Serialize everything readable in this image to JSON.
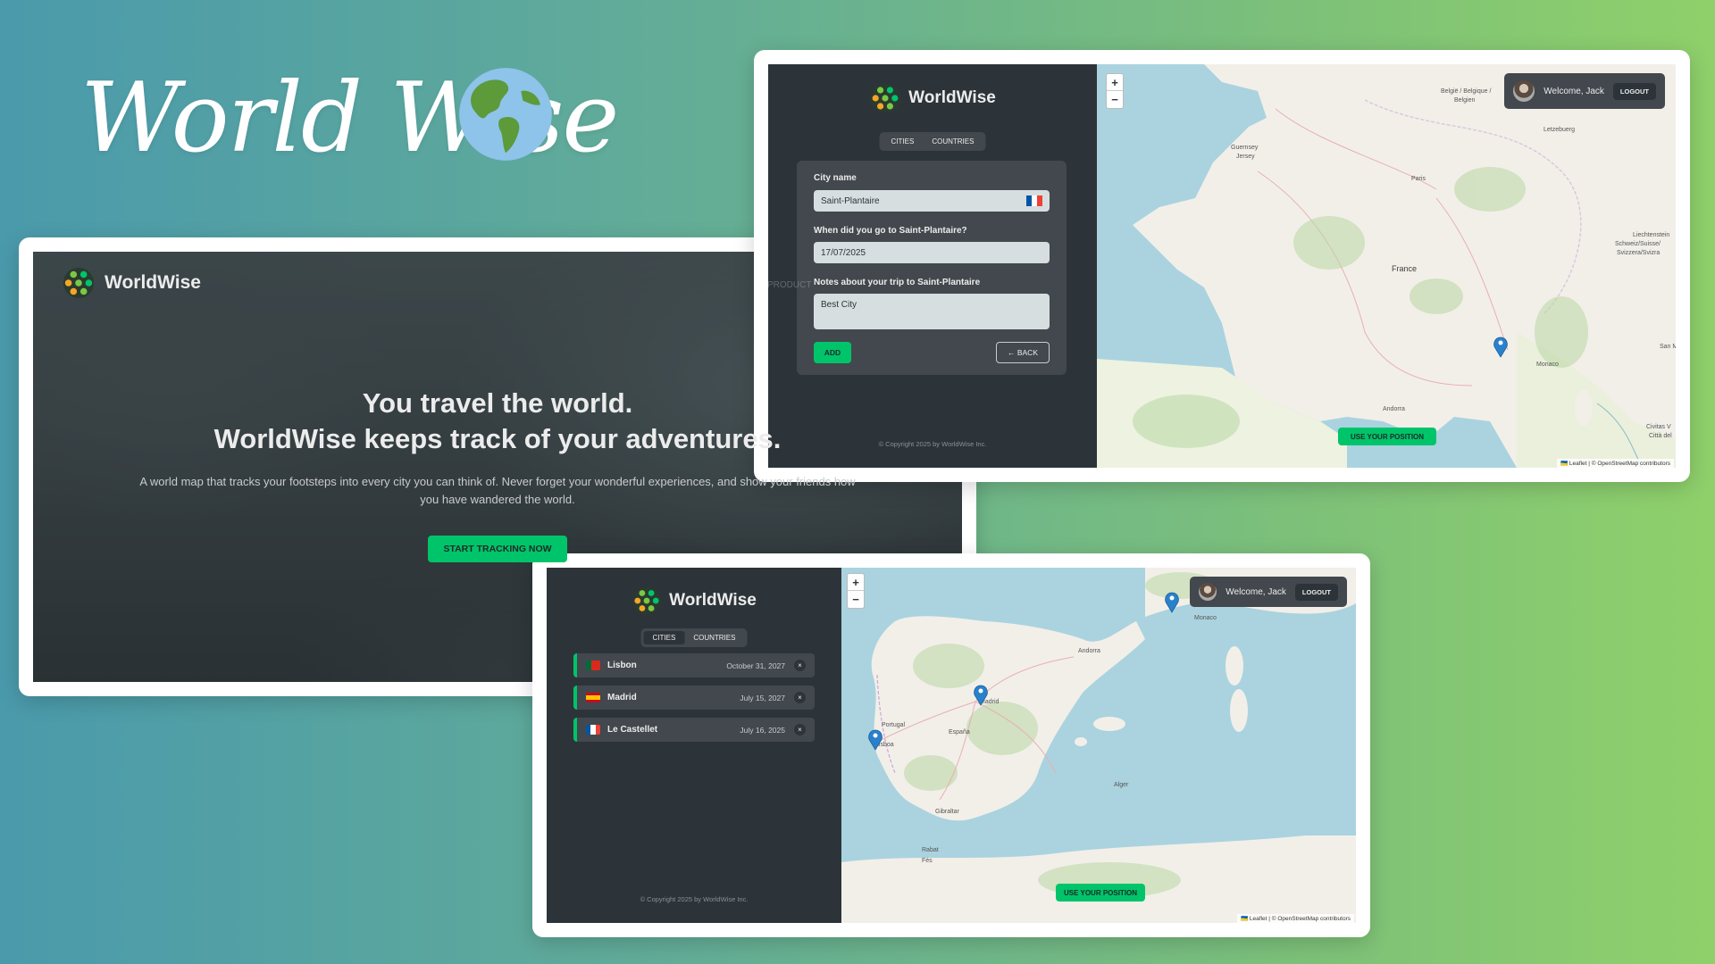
{
  "hero": {
    "script_title": "World Wise"
  },
  "brand": {
    "name": "WorldWise"
  },
  "home": {
    "nav_ghost": "PRODUCT",
    "headline_line1": "You travel the world.",
    "headline_line2": "WorldWise keeps track of your adventures.",
    "description_line1": "A world map that tracks your footsteps into every city you can think of. Never forget your wonderful experiences, and show your friends how",
    "description_line2": "you have wandered the world.",
    "cta_label": "START TRACKING NOW"
  },
  "tabs": {
    "cities": "CITIES",
    "countries": "COUNTRIES"
  },
  "form": {
    "city_label": "City name",
    "city_value": "Saint-Plantaire",
    "date_label": "When did you go to Saint-Plantaire?",
    "date_value": "17/07/2025",
    "notes_label": "Notes about your trip to Saint-Plantaire",
    "notes_value": "Best City",
    "add_label": "ADD",
    "back_label": "← BACK"
  },
  "footer": {
    "copyright": "© Copyright 2025 by WorldWise Inc."
  },
  "user": {
    "welcome": "Welcome, Jack",
    "logout_label": "LOGOUT"
  },
  "map": {
    "zoom_in": "+",
    "zoom_out": "−",
    "use_position": "USE YOUR POSITION",
    "attribution": "🇺🇦 Leaflet | © OpenStreetMap contributors",
    "labels_france": [
      "België / Belgique / Belgien",
      "Letzebuerg",
      "Guernsey",
      "Jersey",
      "Paris",
      "France",
      "Liechtenstein",
      "Schweiz/Suisse/",
      "Svizzera/Svizra",
      "Monaco",
      "Andorra",
      "San M",
      "Civitas V",
      "Città del"
    ],
    "labels_iberia": [
      "Monaco",
      "Andorra",
      "Portugal",
      "Madrid",
      "Lisboa",
      "España",
      "Gibraltar",
      "Rabat",
      "Fès",
      "Alger"
    ]
  },
  "cities": [
    {
      "name": "Lisbon",
      "date": "October 31, 2027",
      "flag": "portugal"
    },
    {
      "name": "Madrid",
      "date": "July 15, 2027",
      "flag": "spain"
    },
    {
      "name": "Le Castellet",
      "date": "July 16, 2025",
      "flag": "france"
    }
  ],
  "colors": {
    "brand_green": "#00c46a",
    "sidebar": "#2d3439",
    "panel": "#42484d",
    "sea": "#aad3df",
    "land": "#f2efe9"
  }
}
